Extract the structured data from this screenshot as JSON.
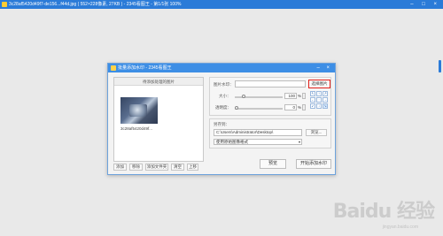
{
  "viewer": {
    "title": "3c28af5420d49f7-de156...f44d.jpg ( 552×228像素, 27KB ) - 2345看图王 - 第1/1张 100%",
    "controls": "– □ ×"
  },
  "dialog": {
    "title": "批量添加水印 - 2345看图王",
    "controls": "– ×",
    "left_panel_header": "待添加处理的图片",
    "thumbnail_name": "3c28af5420d49f...",
    "left_buttons": [
      "添加",
      "移除",
      "添加文件夹",
      "清空",
      "上移"
    ],
    "image_watermark_label": "图片水印：",
    "image_watermark_value": "",
    "select_image_button": "选择图片",
    "size_label": "大小：",
    "size_value": "100",
    "transparency_label": "透明度：",
    "transparency_value": "0",
    "percent_sign": "%",
    "position_grid": [
      "↖",
      "↑",
      "↗",
      "←",
      "·",
      "→",
      "↙",
      "↓",
      "↘"
    ],
    "output_label": "另存到：",
    "output_path": "C:\\Users\\Administrator\\Desktop\\",
    "browse_button": "浏览...",
    "save_mode_option": "使用原始图像格式",
    "preview_button": "预览",
    "start_button": "开始添加水印"
  },
  "watermark": {
    "logo": "Baidu 经验",
    "url": "jingyan.baidu.com"
  },
  "colors": {
    "title_bar": "#2b7bd8",
    "dialog_title": "#3d8ee5",
    "highlight_border": "#e0201a"
  }
}
